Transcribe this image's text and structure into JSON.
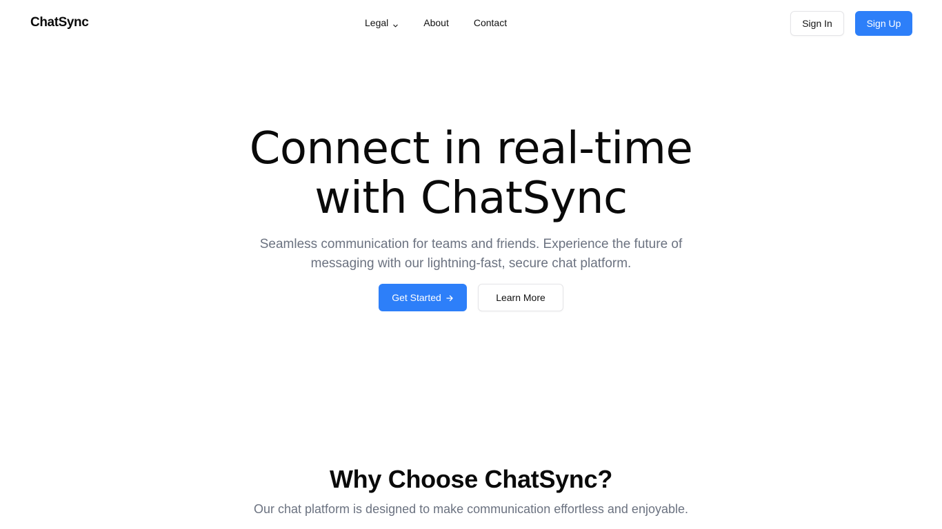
{
  "header": {
    "logo": "ChatSync",
    "nav": {
      "legal": "Legal",
      "about": "About",
      "contact": "Contact"
    },
    "sign_in": "Sign In",
    "sign_up": "Sign Up"
  },
  "hero": {
    "title_line1": "Connect in real-time",
    "title_line2": "with ChatSync",
    "subtitle": "Seamless communication for teams and friends. Experience the future of messaging with our lightning-fast, secure chat platform.",
    "primary_cta": "Get Started",
    "secondary_cta": "Learn More"
  },
  "features": {
    "title": "Why Choose ChatSync?",
    "subtitle": "Our chat platform is designed to make communication effortless and enjoyable."
  },
  "icons": {
    "legal_dropdown": "chevron-down-icon",
    "get_started": "arrow-right-icon"
  },
  "colors": {
    "accent": "#2d7ff9",
    "text_primary": "#0a0a0a",
    "text_muted": "#6b7280",
    "border": "#e4e4e7"
  }
}
